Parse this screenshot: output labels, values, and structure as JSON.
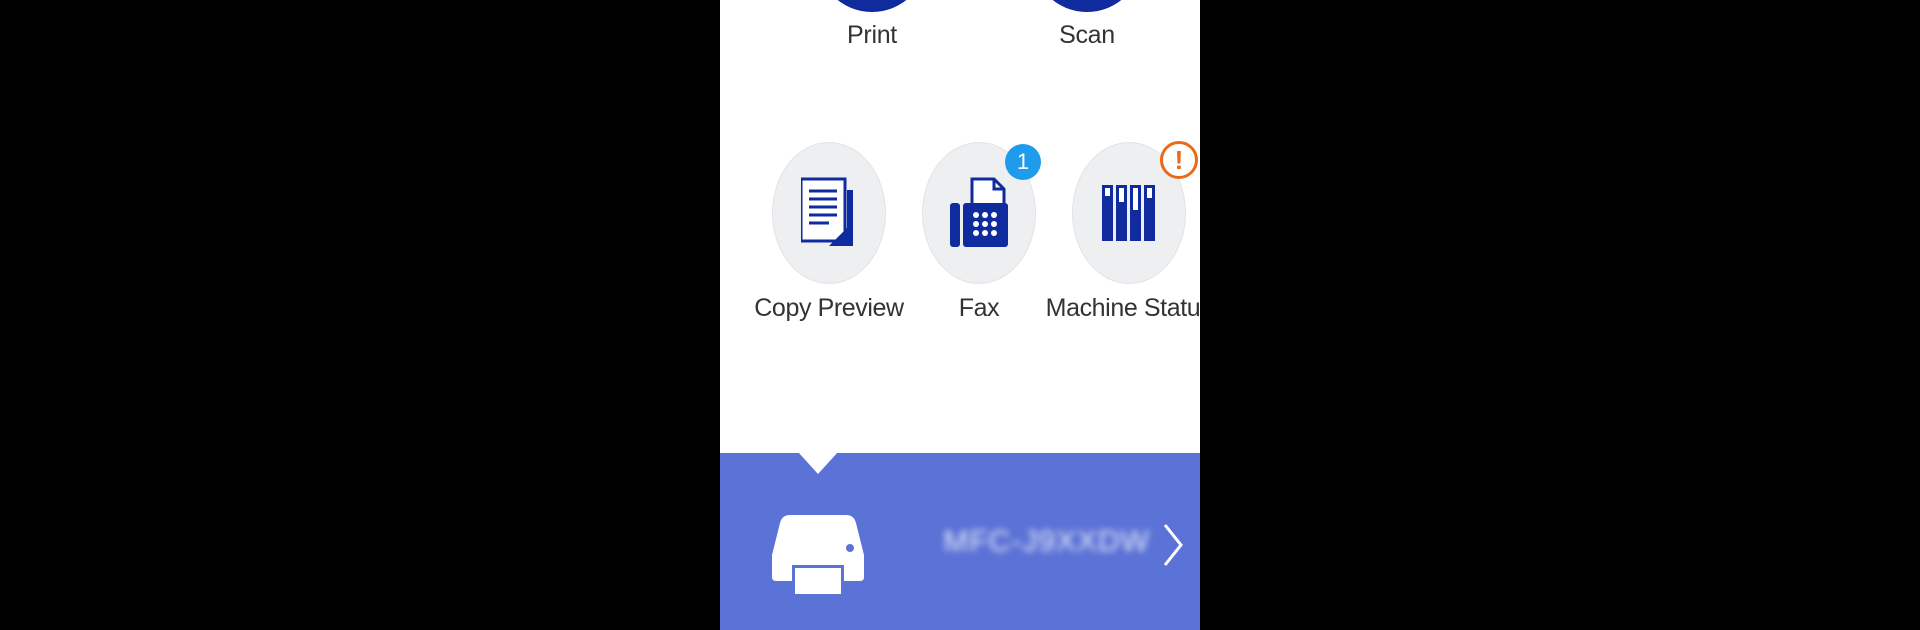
{
  "top_row": [
    {
      "label": "Print"
    },
    {
      "label": "Scan"
    }
  ],
  "functions": [
    {
      "label": "Copy Preview",
      "icon": "copy-preview-icon"
    },
    {
      "label": "Fax",
      "icon": "fax-icon",
      "badge": "1"
    },
    {
      "label": "Machine Status",
      "icon": "machine-status-icon",
      "alert": "!"
    }
  ],
  "device": {
    "name": "MFC-J9XXDW",
    "icon": "printer-icon"
  },
  "colors": {
    "brand_blue": "#0f2b9e",
    "bar_blue": "#5b72d6",
    "badge_blue": "#1e9bea",
    "alert_orange": "#ea6a1a"
  }
}
